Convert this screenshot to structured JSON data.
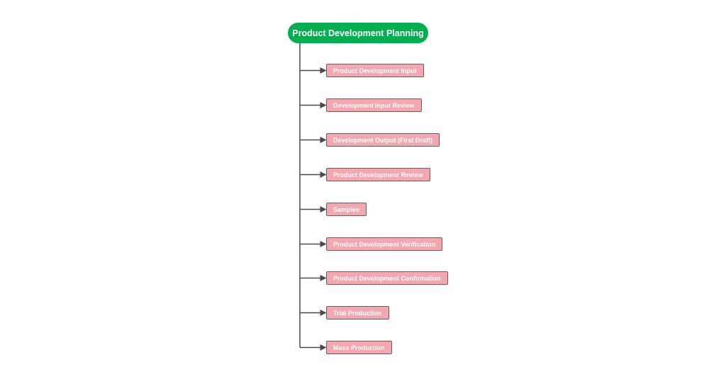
{
  "diagram": {
    "title": "Product Development Planning",
    "root_color": "#00b050",
    "node_color": "#f4a7af",
    "node_border_color": "#6a5b5e",
    "connector_color": "#4a4a4a",
    "steps": [
      {
        "label": "Product Development Input"
      },
      {
        "label": "Development Input Review"
      },
      {
        "label": "Development Output (First Draft)"
      },
      {
        "label": "Product Development Review"
      },
      {
        "label": "Samples"
      },
      {
        "label": "Product Development Verification"
      },
      {
        "label": "Product Development Confirmation"
      },
      {
        "label": "Trial Production"
      },
      {
        "label": "Mass Production"
      }
    ]
  }
}
